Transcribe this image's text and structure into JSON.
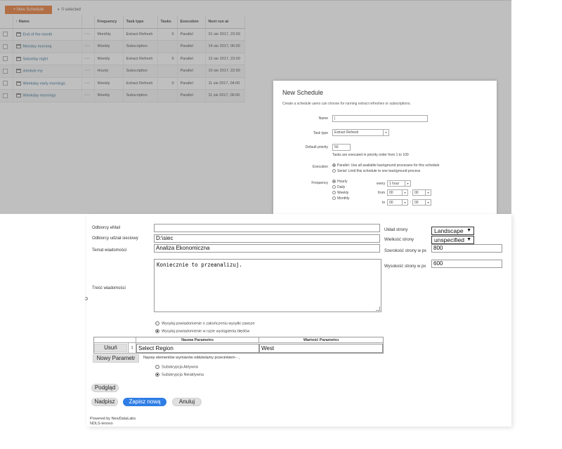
{
  "schedules": {
    "new_button": "+ New Schedule",
    "selected": "0 selected",
    "columns": [
      "Name",
      "Frequency",
      "Task type",
      "Tasks",
      "Execution",
      "Next run at"
    ],
    "rows": [
      {
        "name": "End of the month",
        "frequency": "Monthly",
        "task_type": "Extract Refresh",
        "tasks": "0",
        "execution": "Parallel",
        "next_run": "31 sie 2017, 23:00"
      },
      {
        "name": "Monday morning",
        "frequency": "Weekly",
        "task_type": "Subscription",
        "tasks": "",
        "execution": "Parallel",
        "next_run": "14 sie 2017, 06:00"
      },
      {
        "name": "Saturday night",
        "frequency": "Weekly",
        "task_type": "Extract Refresh",
        "tasks": "0",
        "execution": "Parallel",
        "next_run": "12 sie 2017, 23:00"
      },
      {
        "name": "shedule my",
        "frequency": "Hourly",
        "task_type": "Subscription",
        "tasks": "",
        "execution": "Parallel",
        "next_run": "10 sie 2017, 22:00"
      },
      {
        "name": "Weekday early mornings",
        "frequency": "Weekly",
        "task_type": "Extract Refresh",
        "tasks": "0",
        "execution": "Parallel",
        "next_run": "11 sie 2017, 04:00"
      },
      {
        "name": "Weekday mornings",
        "frequency": "Weekly",
        "task_type": "Subscription",
        "tasks": "",
        "execution": "Parallel",
        "next_run": "11 sie 2017, 06:00"
      }
    ]
  },
  "dialog": {
    "title": "New Schedule",
    "description": "Create a schedule users can choose for running extract refreshes or subscriptions.",
    "name_label": "Name",
    "name_value": "",
    "task_type_label": "Task type",
    "task_type_value": "Extract Refresh",
    "priority_label": "Default priority",
    "priority_value": "50",
    "priority_hint": "Tasks are executed in priority order from 1 to 100",
    "execution_label": "Execution",
    "execution_parallel": "Parallel: Use all available background processes for this schedule",
    "execution_serial": "Serial: Limit this schedule to one background process",
    "frequency_label": "Frequency",
    "frequency_options": [
      "Hourly",
      "Daily",
      "Weekly",
      "Monthly"
    ],
    "every_label": "every",
    "every_value": "1 hour",
    "from_label": "from",
    "from_hour": "00",
    "from_min": "00",
    "to_label": "to",
    "to_hour": "00",
    "to_min": "00"
  },
  "form": {
    "email_label": "Odbiorcy eMail",
    "email_value": "",
    "share_label": "Odbiorcy udział sieciowy",
    "share_value": "D:\\siec",
    "subject_label": "Temat wiadomości",
    "subject_value": "Analiza Ekonomiczna",
    "body_label": "Treść wiadomości",
    "body_value": "Koniecznie to przeanalizuj.",
    "layout_label": "Układ strony",
    "layout_value": "Landscape",
    "size_label": "Wielkość strony",
    "size_value": "unspecified",
    "width_label": "Szerokość strony w px",
    "width_value": "800",
    "height_label": "Wysokość strony w px",
    "height_value": "600",
    "notify_always": "Wysyłaj powiadomienie o zakończeniu wysyłki zawsze",
    "notify_errors": "Wysyłaj powiadomienie w razie wystąpienia błędów",
    "param_name_header": "Nazwa Parametru",
    "param_value_header": "Wartość Parametru",
    "param_remove": "Usuń",
    "param_index": "1",
    "param_name": "Select Region",
    "param_value": "West",
    "new_param_button": "Nowy Parametr",
    "param_hint": "Nazwy elementów wymiarów oddzielamy przecinkiem - ,",
    "sub_active": "Subskrypcja Aktywna",
    "sub_inactive": "Subskrypcja Nieaktywna",
    "preview_button": "Podgląd",
    "overwrite_button": "Nadpisz",
    "save_new_button": "Zapisz nową",
    "cancel_button": "Anuluj",
    "footer_line1": "Powered by NewDataLabs",
    "footer_line2": "NDLS-lenovo"
  }
}
